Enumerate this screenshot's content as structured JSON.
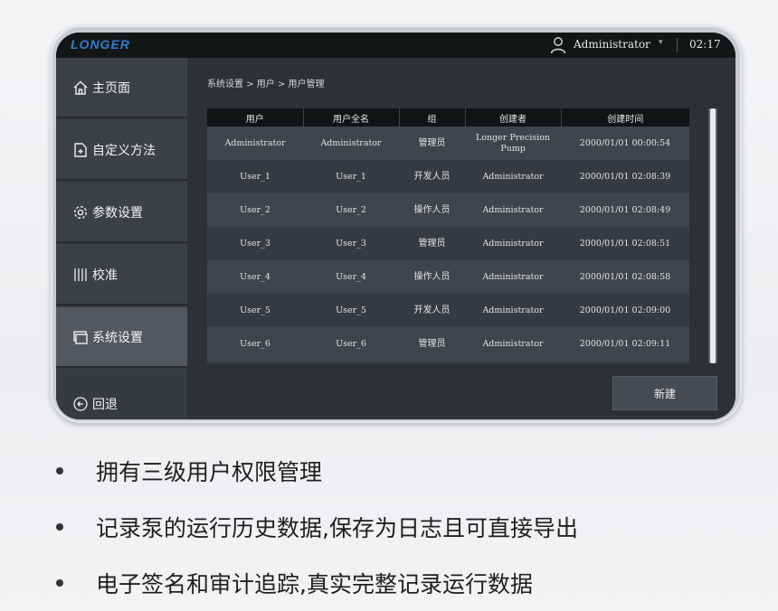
{
  "header": {
    "logo": "LONGER",
    "user": "Administrator",
    "caret": "▾",
    "time": "02:17"
  },
  "sidebar": {
    "items": [
      {
        "label": "主页面",
        "icon": "home-icon"
      },
      {
        "label": "自定义方法",
        "icon": "document-add-icon"
      },
      {
        "label": "参数设置",
        "icon": "gear-icon"
      },
      {
        "label": "校准",
        "icon": "bars-icon"
      },
      {
        "label": "系统设置",
        "icon": "windows-icon"
      }
    ],
    "back_label": "回退",
    "back_icon": "back-arrow-icon"
  },
  "main": {
    "breadcrumb": "系统设置 > 用户 > 用户管理",
    "table": {
      "headers": [
        "用户",
        "用户全名",
        "组",
        "创建者",
        "创建时间"
      ],
      "rows": [
        {
          "user": "Administrator",
          "fullname": "Administrator",
          "group": "管理员",
          "creator": "Longer Precision Pump",
          "created": "2000/01/01 00:00:54"
        },
        {
          "user": "User_1",
          "fullname": "User_1",
          "group": "开发人员",
          "creator": "Administrator",
          "created": "2000/01/01 02:08:39"
        },
        {
          "user": "User_2",
          "fullname": "User_2",
          "group": "操作人员",
          "creator": "Administrator",
          "created": "2000/01/01 02:08:49"
        },
        {
          "user": "User_3",
          "fullname": "User_3",
          "group": "管理员",
          "creator": "Administrator",
          "created": "2000/01/01 02:08:51"
        },
        {
          "user": "User_4",
          "fullname": "User_4",
          "group": "操作人员",
          "creator": "Administrator",
          "created": "2000/01/01 02:08:58"
        },
        {
          "user": "User_5",
          "fullname": "User_5",
          "group": "开发人员",
          "creator": "Administrator",
          "created": "2000/01/01 02:09:00"
        },
        {
          "user": "User_6",
          "fullname": "User_6",
          "group": "管理员",
          "creator": "Administrator",
          "created": "2000/01/01 02:09:11"
        }
      ]
    },
    "new_button": "新建"
  },
  "features": [
    "拥有三级用户权限管理",
    "记录泵的运行历史数据,保存为日志且可直接导出",
    "电子签名和审计追踪,真实完整记录运行数据"
  ]
}
